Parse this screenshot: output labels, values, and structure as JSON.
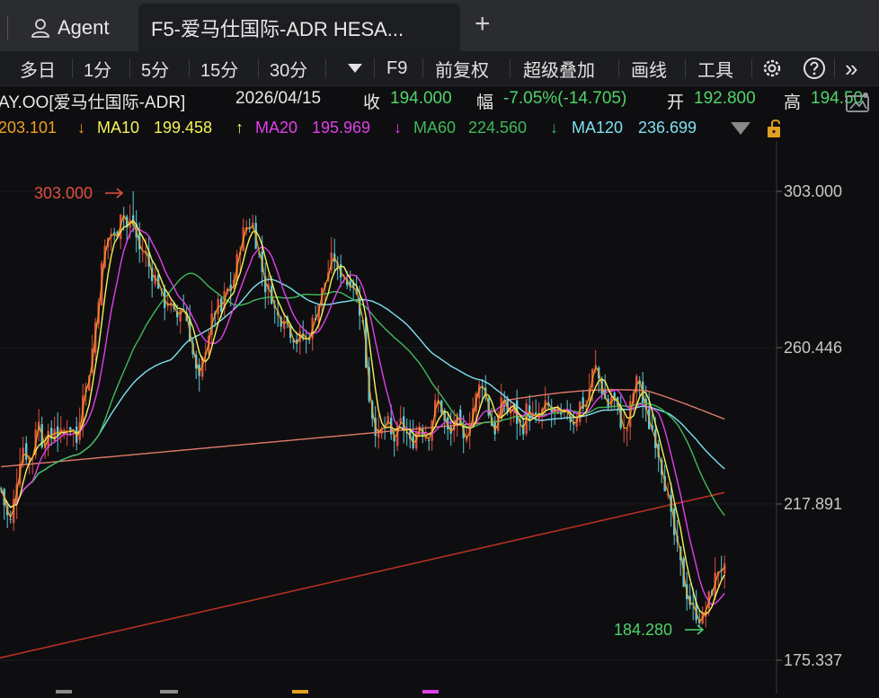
{
  "tabs": {
    "agent_label": "Agent",
    "stock_label": "F5-爱马仕国际-ADR HESA...",
    "add_label": "+"
  },
  "toolbar": {
    "multi_day": "多日",
    "m1": "1分",
    "m5": "5分",
    "m15": "15分",
    "m30": "30分",
    "f9": "F9",
    "adjust": "前复权",
    "overlay": "超级叠加",
    "draw": "画线",
    "tools": "工具",
    "more": "»"
  },
  "info": {
    "symbol": "AY.OO[爱马仕国际-ADR]",
    "date": "2026/04/15",
    "close_label": "收",
    "close": "194.000",
    "change_label": "幅",
    "change": "-7.05%(-14.705)",
    "open_label": "开",
    "open": "192.800",
    "high_label": "高",
    "high": "194.50"
  },
  "ma": {
    "ma5_value": "203.101",
    "ma5_arrow": "↓",
    "ma10_label": "MA10",
    "ma10_value": "199.458",
    "ma10_arrow": "↑",
    "ma20_label": "MA20",
    "ma20_value": "195.969",
    "ma20_arrow": "↓",
    "ma60_label": "MA60",
    "ma60_value": "224.560",
    "ma60_arrow": "↓",
    "ma120_label": "MA120",
    "ma120_value": "236.699",
    "colors": {
      "ma5": "#f0a020",
      "ma10": "#f5f25a",
      "ma20": "#e040e8",
      "ma60": "#3fba5a",
      "ma120": "#7fe0f0",
      "ma250": "#e07a6a",
      "long": "#b83020"
    }
  },
  "chart_data": {
    "type": "candlestick",
    "y_ticks": [
      "303.000",
      "260.446",
      "217.891",
      "175.337"
    ],
    "ylim": [
      175.337,
      303.0
    ],
    "high_marker": "303.000",
    "low_marker": "184.280",
    "up_color": "#e05040",
    "down_color": "#60c8d8"
  }
}
